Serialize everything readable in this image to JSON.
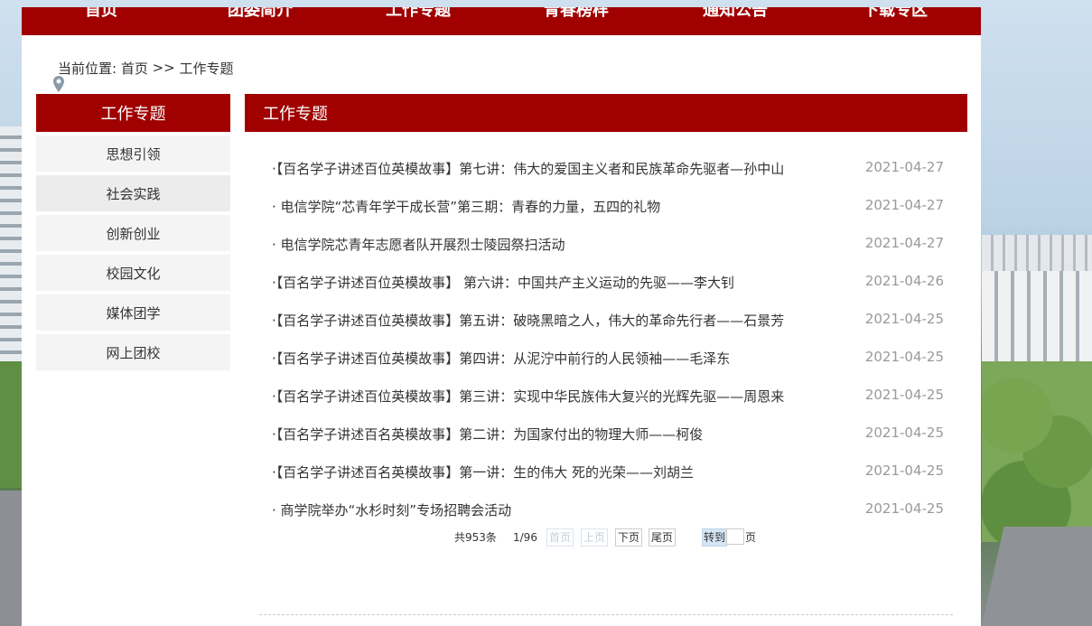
{
  "nav": {
    "items": [
      "首页",
      "团委简介",
      "工作专题",
      "青春榜样",
      "通知公告",
      "下载专区"
    ]
  },
  "breadcrumb": {
    "label": "当前位置: ",
    "home": "首页",
    "separator": " >> ",
    "current": "工作专题"
  },
  "sidebar": {
    "title": "工作专题",
    "items": [
      "思想引领",
      "社会实践",
      "创新创业",
      "校园文化",
      "媒体团学",
      "网上团校"
    ],
    "active_index": 1
  },
  "content": {
    "title": "工作专题",
    "articles": [
      {
        "title": "·【百名学子讲述百位英模故事】第七讲：伟大的爱国主义者和民族革命先驱者—孙中山",
        "date": "2021-04-27"
      },
      {
        "title": "· 电信学院“芯青年学干成长营”第三期：青春的力量，五四的礼物",
        "date": "2021-04-27"
      },
      {
        "title": "· 电信学院芯青年志愿者队开展烈士陵园祭扫活动",
        "date": "2021-04-27"
      },
      {
        "title": "·【百名学子讲述百位英模故事】 第六讲：中国共产主义运动的先驱——李大钊",
        "date": "2021-04-26"
      },
      {
        "title": "·【百名学子讲述百位英模故事】第五讲：破晓黑暗之人，伟大的革命先行者——石景芳",
        "date": "2021-04-25"
      },
      {
        "title": "·【百名学子讲述百位英模故事】第四讲：从泥泞中前行的人民领袖——毛泽东",
        "date": "2021-04-25"
      },
      {
        "title": "·【百名学子讲述百位英模故事】第三讲：实现中华民族伟大复兴的光辉先驱——周恩来",
        "date": "2021-04-25"
      },
      {
        "title": "·【百名学子讲述百名英模故事】第二讲：为国家付出的物理大师——柯俊",
        "date": "2021-04-25"
      },
      {
        "title": "·【百名学子讲述百名英模故事】第一讲：生的伟大 死的光荣——刘胡兰",
        "date": "2021-04-25"
      },
      {
        "title": "· 商学院举办“水杉时刻”专场招聘会活动",
        "date": "2021-04-25"
      }
    ]
  },
  "pager": {
    "total": "共953条",
    "page_info": "1/96",
    "first": "首页",
    "prev": "上页",
    "next": "下页",
    "last": "尾页",
    "goto": "转到",
    "page_suffix": "页",
    "page_value": ""
  },
  "colors": {
    "brand_red": "#a00000",
    "date_gray": "#999999"
  }
}
